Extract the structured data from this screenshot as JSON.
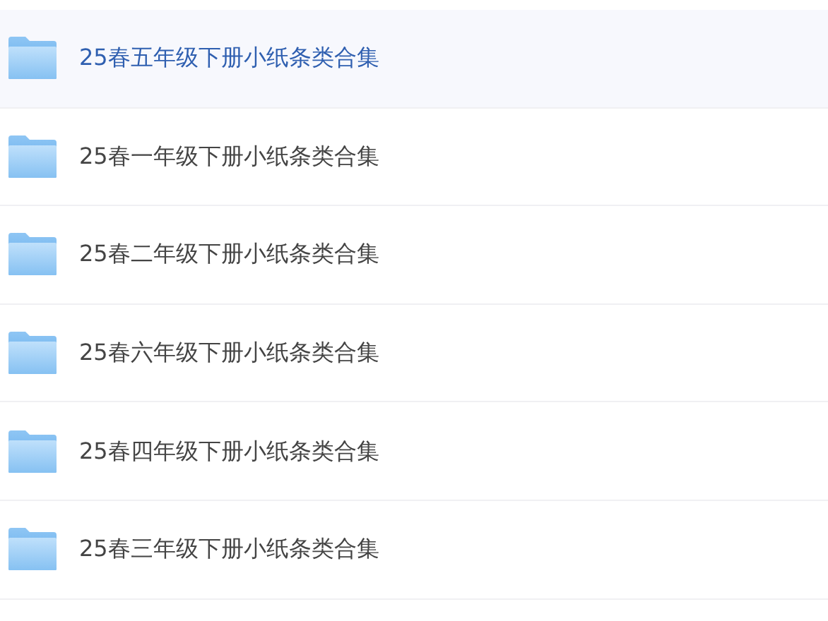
{
  "folders": [
    {
      "name": "25春五年级下册小纸条类合集",
      "selected": true
    },
    {
      "name": "25春一年级下册小纸条类合集",
      "selected": false
    },
    {
      "name": "25春二年级下册小纸条类合集",
      "selected": false
    },
    {
      "name": "25春六年级下册小纸条类合集",
      "selected": false
    },
    {
      "name": "25春四年级下册小纸条类合集",
      "selected": false
    },
    {
      "name": "25春三年级下册小纸条类合集",
      "selected": false
    }
  ]
}
